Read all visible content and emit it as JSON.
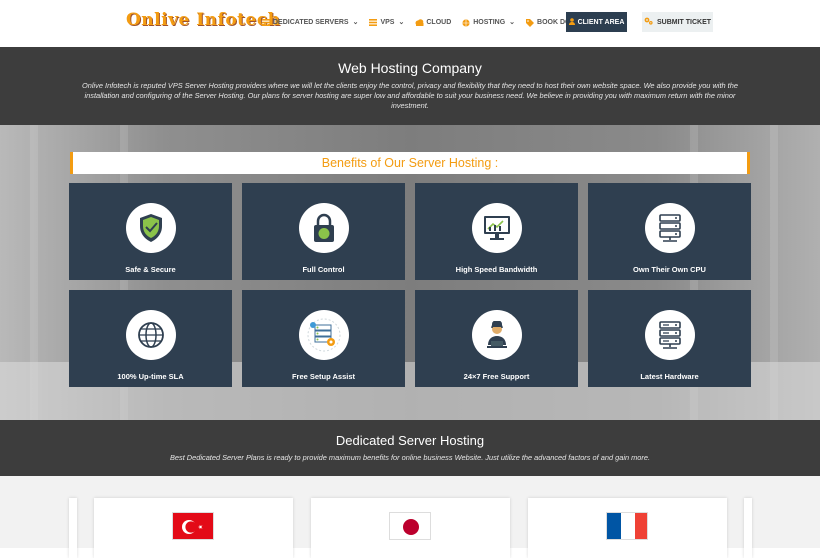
{
  "header": {
    "logo": "Onlive Infotech",
    "nav": [
      {
        "label": "DEDICATED SERVERS",
        "icon": "list-icon",
        "caret": true
      },
      {
        "label": "VPS",
        "icon": "list-icon",
        "caret": true
      },
      {
        "label": "CLOUD",
        "icon": "cloud-icon",
        "caret": false
      },
      {
        "label": "HOSTING",
        "icon": "globe-icon",
        "caret": true
      },
      {
        "label": "BOOK DOMAINS",
        "icon": "tag-icon",
        "caret": false
      }
    ],
    "client_area": "CLIENT AREA",
    "submit_ticket": "SUBMIT TICKET"
  },
  "intro": {
    "title": "Web Hosting Company",
    "text": "Onlive Infotech is reputed VPS Server Hosting providers where we will let the clients enjoy the control, privacy and flexibility that they need to host their own website space. We also provide you with the installation and configuring of the Server Hosting. Our plans for server hosting are super low and affordable to suit your business need. We believe in providing you with maximum return with the minor investment."
  },
  "benefits": {
    "title": "Benefits of Our Server Hosting :",
    "cards": [
      {
        "label": "Safe & Secure",
        "icon": "shield-check-icon"
      },
      {
        "label": "Full Control",
        "icon": "padlock-icon"
      },
      {
        "label": "High Speed Bandwidth",
        "icon": "monitor-chart-icon"
      },
      {
        "label": "Own Their Own CPU",
        "icon": "server-stack-icon"
      },
      {
        "label": "100% Up-time SLA",
        "icon": "globe-icon"
      },
      {
        "label": "Free Setup Assist",
        "icon": "server-setup-icon"
      },
      {
        "label": "24×7 Free Support",
        "icon": "support-agent-icon"
      },
      {
        "label": "Latest Hardware",
        "icon": "server-rack-icon"
      }
    ]
  },
  "dedicated": {
    "title": "Dedicated Server Hosting",
    "text": "Best Dedicated Server Plans is ready to provide maximum benefits for online business Website. Just utilize the advanced factors of and gain more."
  },
  "plans": [
    {
      "country_flag": "turkey-flag-icon"
    },
    {
      "country_flag": "japan-flag-icon"
    },
    {
      "country_flag": "france-flag-icon"
    }
  ],
  "colors": {
    "accent": "#f39c12",
    "card_bg": "#2f3f50",
    "band_bg": "#3d3d3d",
    "client_btn": "#2c3e50"
  }
}
